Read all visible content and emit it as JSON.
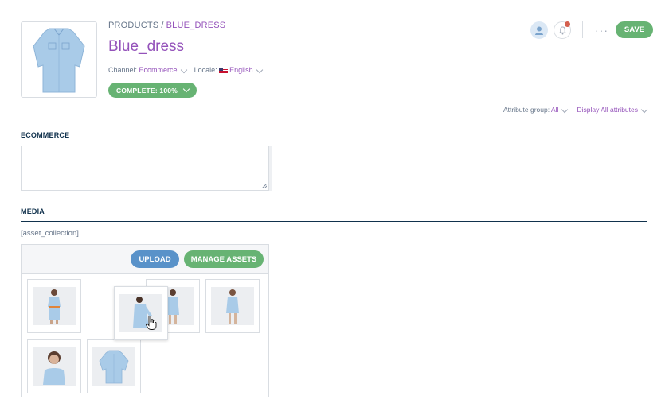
{
  "breadcrumb": {
    "root": "PRODUCTS",
    "separator": "/",
    "current": "BLUE_DRESS"
  },
  "product": {
    "title": "Blue_dress",
    "thumbnail_icon": "dress-image"
  },
  "context": {
    "channel_label": "Channel:",
    "channel_value": "Ecommerce",
    "locale_label": "Locale:",
    "locale_value": "English",
    "locale_flag_icon": "us-flag-icon"
  },
  "completeness": {
    "label": "COMPLETE: 100%",
    "percent": 100
  },
  "header_actions": {
    "user_icon": "user-avatar-icon",
    "bell_icon": "bell-icon",
    "more_label": "···",
    "save_label": "SAVE"
  },
  "filters": {
    "attribute_group_label": "Attribute group:",
    "attribute_group_value": "All",
    "display_label": "Display All attributes"
  },
  "sections": {
    "ecommerce": {
      "title": "ECOMMERCE"
    },
    "media": {
      "title": "MEDIA",
      "field_label": "[asset_collection]"
    }
  },
  "assets": {
    "upload_label": "UPLOAD",
    "manage_label": "MANAGE ASSETS",
    "items": [
      {
        "image": "model-standing-front",
        "dragging": false
      },
      {
        "image": "model-side-pose",
        "dragging": true
      },
      {
        "image": "model-full-length",
        "dragging": false
      },
      {
        "image": "model-full-length-2",
        "dragging": false
      },
      {
        "image": "model-portrait",
        "dragging": false
      },
      {
        "image": "dress-flat",
        "dragging": false
      }
    ]
  },
  "colors": {
    "brand_purple": "#9452ba",
    "green": "#67b373",
    "blue": "#5992c9",
    "text": "#67768a",
    "section_line": "#11324d"
  }
}
